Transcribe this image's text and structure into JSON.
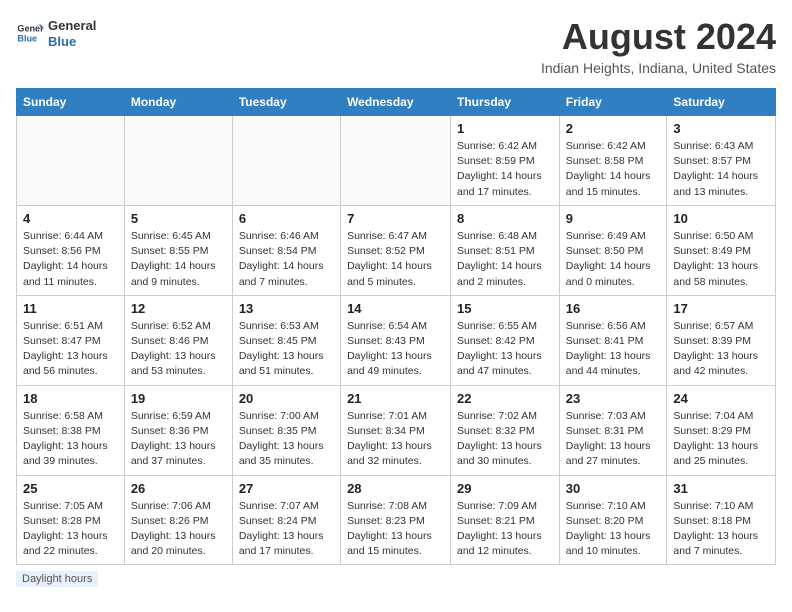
{
  "header": {
    "logo_line1": "General",
    "logo_line2": "Blue",
    "month_title": "August 2024",
    "location": "Indian Heights, Indiana, United States"
  },
  "weekdays": [
    "Sunday",
    "Monday",
    "Tuesday",
    "Wednesday",
    "Thursday",
    "Friday",
    "Saturday"
  ],
  "weeks": [
    [
      {
        "day": "",
        "info": ""
      },
      {
        "day": "",
        "info": ""
      },
      {
        "day": "",
        "info": ""
      },
      {
        "day": "",
        "info": ""
      },
      {
        "day": "1",
        "info": "Sunrise: 6:42 AM\nSunset: 8:59 PM\nDaylight: 14 hours\nand 17 minutes."
      },
      {
        "day": "2",
        "info": "Sunrise: 6:42 AM\nSunset: 8:58 PM\nDaylight: 14 hours\nand 15 minutes."
      },
      {
        "day": "3",
        "info": "Sunrise: 6:43 AM\nSunset: 8:57 PM\nDaylight: 14 hours\nand 13 minutes."
      }
    ],
    [
      {
        "day": "4",
        "info": "Sunrise: 6:44 AM\nSunset: 8:56 PM\nDaylight: 14 hours\nand 11 minutes."
      },
      {
        "day": "5",
        "info": "Sunrise: 6:45 AM\nSunset: 8:55 PM\nDaylight: 14 hours\nand 9 minutes."
      },
      {
        "day": "6",
        "info": "Sunrise: 6:46 AM\nSunset: 8:54 PM\nDaylight: 14 hours\nand 7 minutes."
      },
      {
        "day": "7",
        "info": "Sunrise: 6:47 AM\nSunset: 8:52 PM\nDaylight: 14 hours\nand 5 minutes."
      },
      {
        "day": "8",
        "info": "Sunrise: 6:48 AM\nSunset: 8:51 PM\nDaylight: 14 hours\nand 2 minutes."
      },
      {
        "day": "9",
        "info": "Sunrise: 6:49 AM\nSunset: 8:50 PM\nDaylight: 14 hours\nand 0 minutes."
      },
      {
        "day": "10",
        "info": "Sunrise: 6:50 AM\nSunset: 8:49 PM\nDaylight: 13 hours\nand 58 minutes."
      }
    ],
    [
      {
        "day": "11",
        "info": "Sunrise: 6:51 AM\nSunset: 8:47 PM\nDaylight: 13 hours\nand 56 minutes."
      },
      {
        "day": "12",
        "info": "Sunrise: 6:52 AM\nSunset: 8:46 PM\nDaylight: 13 hours\nand 53 minutes."
      },
      {
        "day": "13",
        "info": "Sunrise: 6:53 AM\nSunset: 8:45 PM\nDaylight: 13 hours\nand 51 minutes."
      },
      {
        "day": "14",
        "info": "Sunrise: 6:54 AM\nSunset: 8:43 PM\nDaylight: 13 hours\nand 49 minutes."
      },
      {
        "day": "15",
        "info": "Sunrise: 6:55 AM\nSunset: 8:42 PM\nDaylight: 13 hours\nand 47 minutes."
      },
      {
        "day": "16",
        "info": "Sunrise: 6:56 AM\nSunset: 8:41 PM\nDaylight: 13 hours\nand 44 minutes."
      },
      {
        "day": "17",
        "info": "Sunrise: 6:57 AM\nSunset: 8:39 PM\nDaylight: 13 hours\nand 42 minutes."
      }
    ],
    [
      {
        "day": "18",
        "info": "Sunrise: 6:58 AM\nSunset: 8:38 PM\nDaylight: 13 hours\nand 39 minutes."
      },
      {
        "day": "19",
        "info": "Sunrise: 6:59 AM\nSunset: 8:36 PM\nDaylight: 13 hours\nand 37 minutes."
      },
      {
        "day": "20",
        "info": "Sunrise: 7:00 AM\nSunset: 8:35 PM\nDaylight: 13 hours\nand 35 minutes."
      },
      {
        "day": "21",
        "info": "Sunrise: 7:01 AM\nSunset: 8:34 PM\nDaylight: 13 hours\nand 32 minutes."
      },
      {
        "day": "22",
        "info": "Sunrise: 7:02 AM\nSunset: 8:32 PM\nDaylight: 13 hours\nand 30 minutes."
      },
      {
        "day": "23",
        "info": "Sunrise: 7:03 AM\nSunset: 8:31 PM\nDaylight: 13 hours\nand 27 minutes."
      },
      {
        "day": "24",
        "info": "Sunrise: 7:04 AM\nSunset: 8:29 PM\nDaylight: 13 hours\nand 25 minutes."
      }
    ],
    [
      {
        "day": "25",
        "info": "Sunrise: 7:05 AM\nSunset: 8:28 PM\nDaylight: 13 hours\nand 22 minutes."
      },
      {
        "day": "26",
        "info": "Sunrise: 7:06 AM\nSunset: 8:26 PM\nDaylight: 13 hours\nand 20 minutes."
      },
      {
        "day": "27",
        "info": "Sunrise: 7:07 AM\nSunset: 8:24 PM\nDaylight: 13 hours\nand 17 minutes."
      },
      {
        "day": "28",
        "info": "Sunrise: 7:08 AM\nSunset: 8:23 PM\nDaylight: 13 hours\nand 15 minutes."
      },
      {
        "day": "29",
        "info": "Sunrise: 7:09 AM\nSunset: 8:21 PM\nDaylight: 13 hours\nand 12 minutes."
      },
      {
        "day": "30",
        "info": "Sunrise: 7:10 AM\nSunset: 8:20 PM\nDaylight: 13 hours\nand 10 minutes."
      },
      {
        "day": "31",
        "info": "Sunrise: 7:10 AM\nSunset: 8:18 PM\nDaylight: 13 hours\nand 7 minutes."
      }
    ]
  ],
  "footer": {
    "label": "Daylight hours"
  }
}
